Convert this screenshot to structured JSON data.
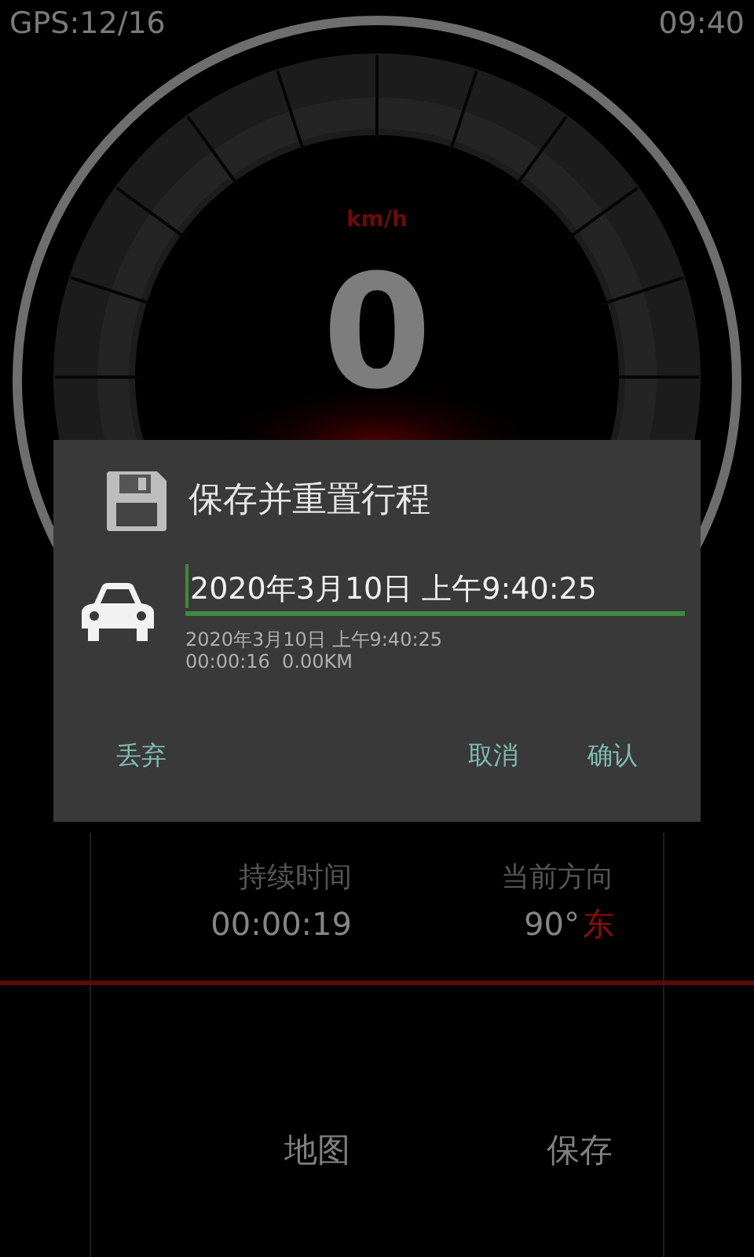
{
  "status_bar": {
    "gps": "GPS:12/16",
    "time": "09:40"
  },
  "speedometer": {
    "unit": "km/h",
    "speed": "0"
  },
  "dialog": {
    "title": "保存并重置行程",
    "name_field": {
      "value": "2020年3月10日 上午9:40:25",
      "focused": true
    },
    "details": [
      "2020年3月10日 上午9:40:25",
      "00:00:16  0.00KM"
    ],
    "buttons": [
      {
        "label": "丢弃",
        "kind": "left"
      },
      {
        "label": "取消",
        "kind": "right"
      },
      {
        "label": "确认",
        "kind": "right"
      }
    ]
  },
  "stats": [
    {
      "label": "持续时间",
      "value": "00:00:19"
    },
    {
      "label": "当前方向",
      "value": "90°",
      "direction": "东"
    }
  ],
  "bottom_buttons": [
    "地图",
    "保存"
  ]
}
